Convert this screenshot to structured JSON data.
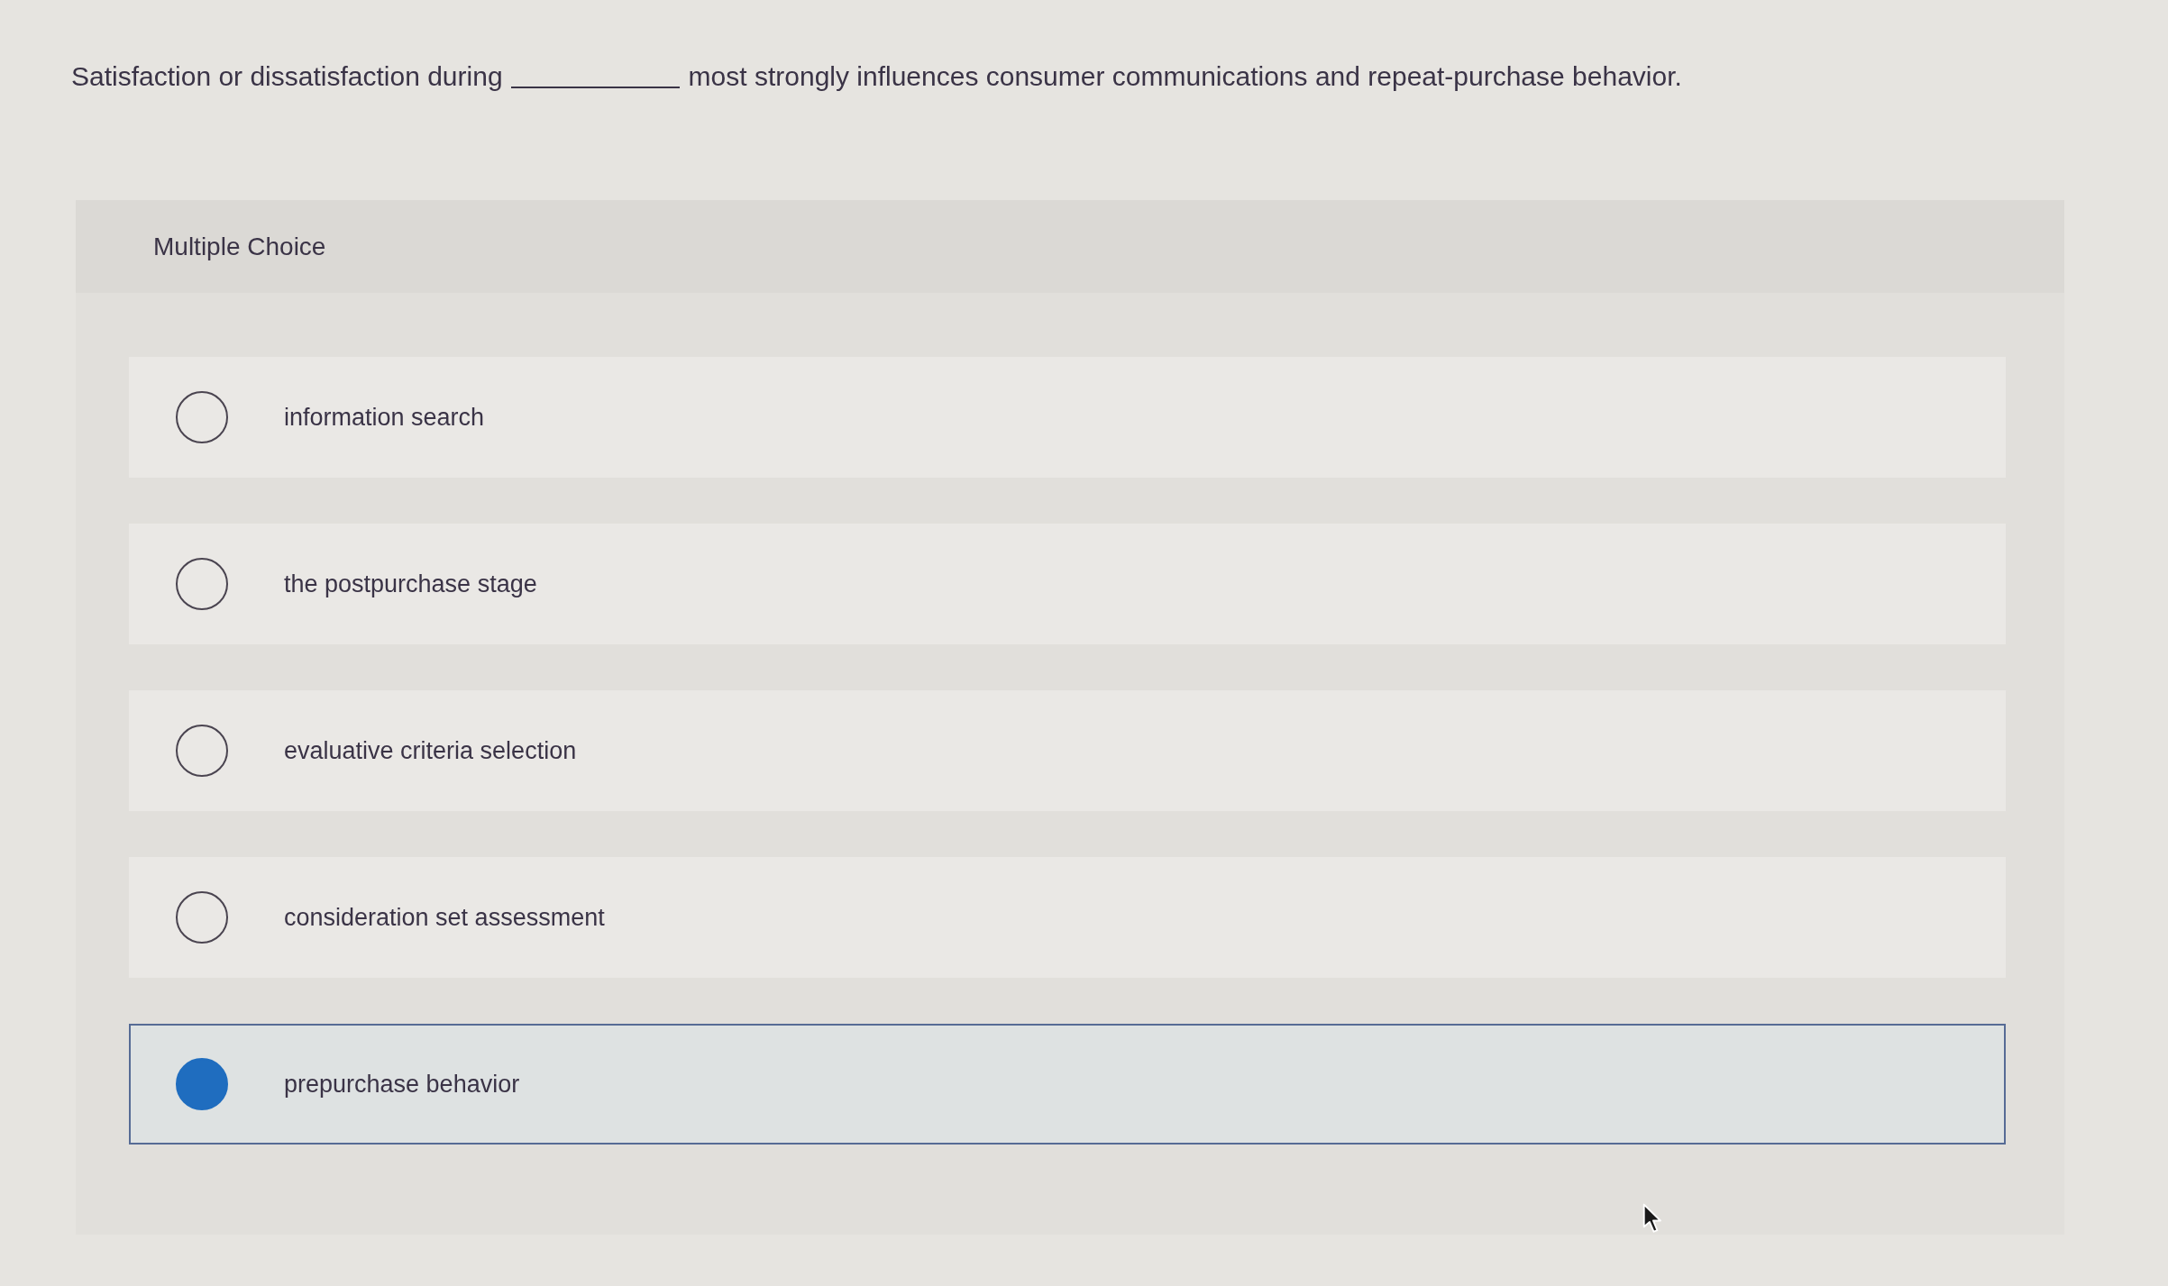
{
  "question": {
    "before": "Satisfaction or dissatisfaction during",
    "after": "most strongly influences consumer communications and repeat-purchase behavior."
  },
  "question_type": "Multiple Choice",
  "options": [
    {
      "label": "information search",
      "selected": false
    },
    {
      "label": "the postpurchase stage",
      "selected": false
    },
    {
      "label": "evaluative criteria selection",
      "selected": false
    },
    {
      "label": "consideration set assessment",
      "selected": false
    },
    {
      "label": "prepurchase behavior",
      "selected": true
    }
  ]
}
